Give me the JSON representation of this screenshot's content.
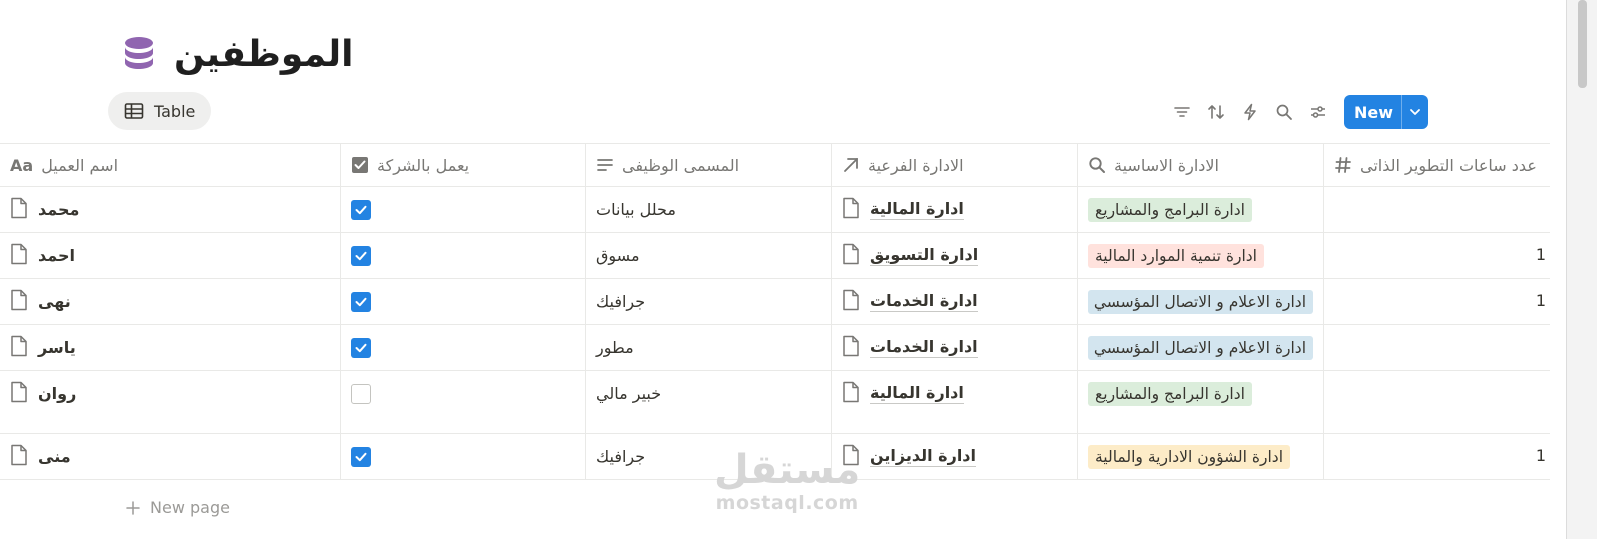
{
  "page": {
    "title": "الموظفين",
    "icon": "database-icon"
  },
  "view_tab": {
    "label": "Table",
    "icon": "table-icon"
  },
  "toolbar": {
    "new_label": "New",
    "icons": [
      "filter-icon",
      "sort-icon",
      "automation-icon",
      "search-icon",
      "settings-icon"
    ]
  },
  "columns": {
    "name": "اسم العميل",
    "works": "يعمل بالشركة",
    "job": "المسمى الوظيفى",
    "sub_dept": "الادارة الفرعية",
    "main_dept": "الادارة الاساسية",
    "hours": "عدد ساعات التطوير الذاتى"
  },
  "rows": [
    {
      "name": "محمد",
      "works": true,
      "job": "محلل بيانات",
      "sub_dept": "ادارة المالية",
      "main_dept": "ادارة البرامج والمشاريع",
      "main_color": "green",
      "hours": ""
    },
    {
      "name": "احمد",
      "works": true,
      "job": "مسوق",
      "sub_dept": "ادارة التسويق",
      "main_dept": "ادارة تنمية الموارد المالية",
      "main_color": "red",
      "hours": "1"
    },
    {
      "name": "نهى",
      "works": true,
      "job": "جرافيك",
      "sub_dept": "ادارة الخدمات",
      "main_dept": "ادارة الاعلام و الاتصال المؤسسي",
      "main_color": "blue",
      "hours": "1"
    },
    {
      "name": "ياسر",
      "works": true,
      "job": "مطور",
      "sub_dept": "ادارة الخدمات",
      "main_dept": "ادارة الاعلام و الاتصال المؤسسي",
      "main_color": "blue",
      "hours": ""
    },
    {
      "name": "روان",
      "works": false,
      "job": "خبير مالي",
      "sub_dept": "ادارة المالية",
      "main_dept": "ادارة البرامج والمشاريع",
      "main_color": "green",
      "hours": ""
    },
    {
      "name": "منى",
      "works": true,
      "job": "جرافيك",
      "sub_dept": "ادارة الديزاين",
      "main_dept": "ادارة الشؤون الادارية والمالية",
      "main_color": "yellow",
      "hours": "1"
    }
  ],
  "new_page_label": "New page",
  "tag_colors": {
    "green": "#dbeddb",
    "red": "#ffe2dd",
    "blue": "#d3e5ef",
    "yellow": "#fdecc8"
  },
  "accent": "#2383e2",
  "watermark": {
    "arabic": "مستقل",
    "english": "mostaql.com"
  }
}
